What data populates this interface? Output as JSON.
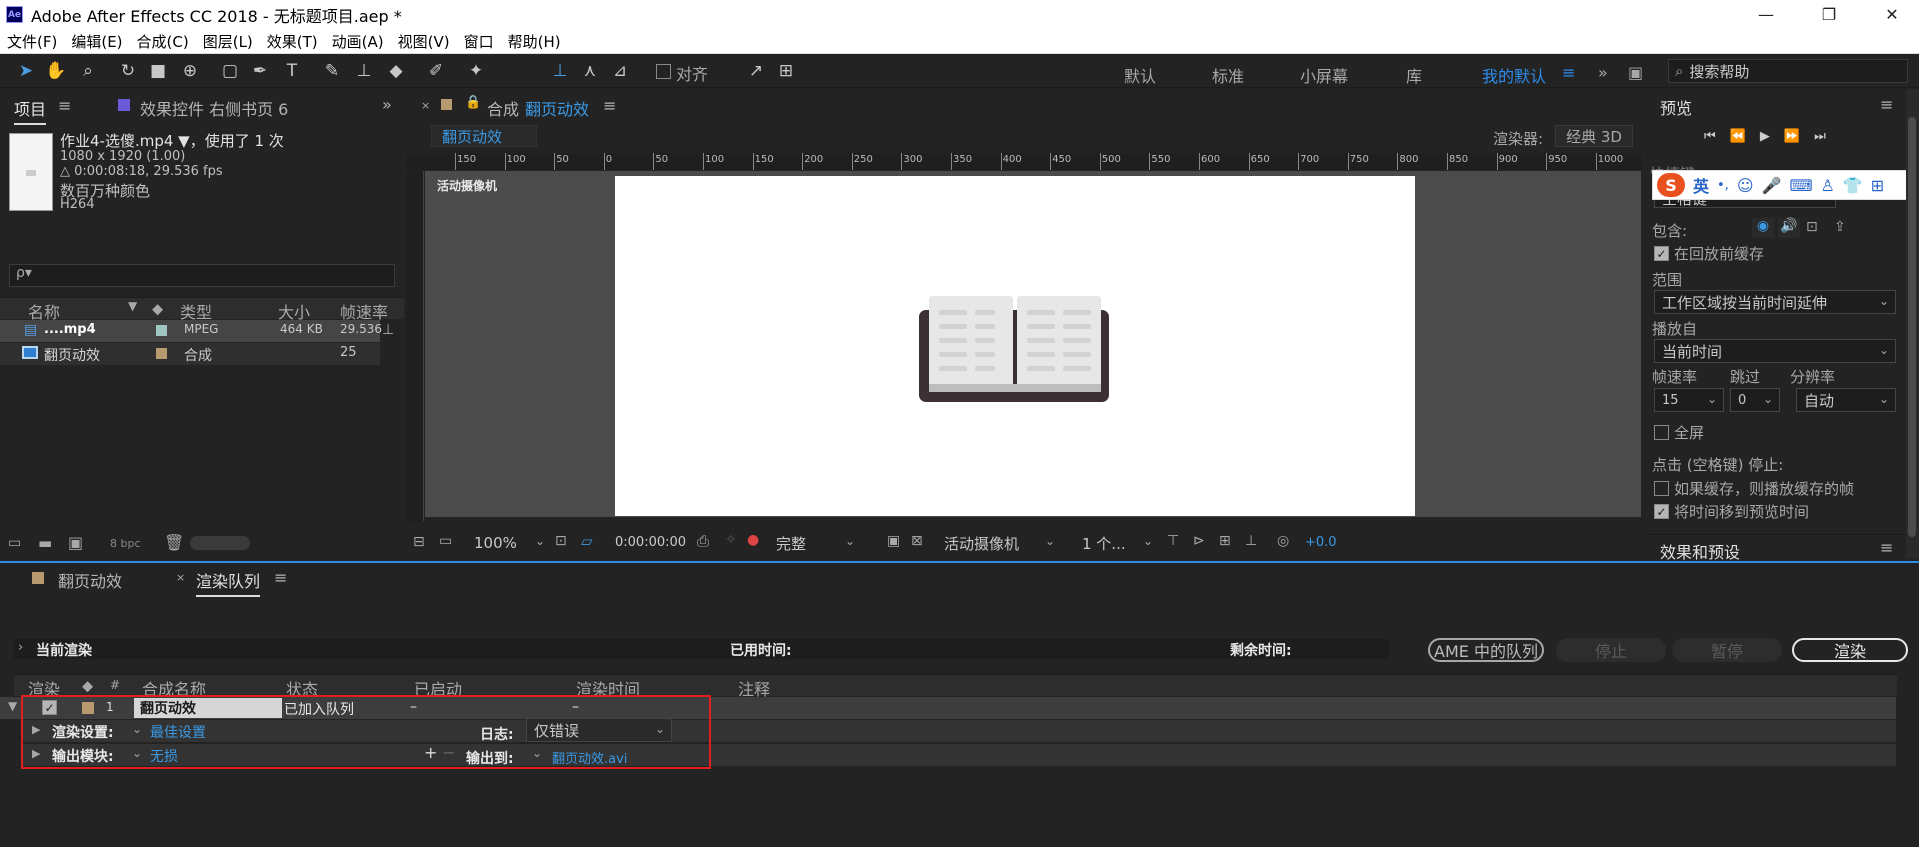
{
  "titlebar": {
    "title": "Adobe After Effects CC 2018 - 无标题项目.aep *",
    "logo": "Ae",
    "min": "—",
    "max": "❐",
    "close": "✕"
  },
  "menu": [
    "文件(F)",
    "编辑(E)",
    "合成(C)",
    "图层(L)",
    "效果(T)",
    "动画(A)",
    "视图(V)",
    "窗口",
    "帮助(H)"
  ],
  "toolbar": {
    "align_label": "对齐",
    "workspaces": [
      "默认",
      "标准",
      "小屏幕",
      "库",
      "我的默认"
    ],
    "search_placeholder": "搜索帮助"
  },
  "project_panel": {
    "tab_project": "项目",
    "tab_effects": "效果控件 右侧书页 6",
    "file_name": "作业4-选傻.mp4 ▼，使用了 1 次",
    "file_dims": "1080 x 1920 (1.00)",
    "file_duration": "△ 0:00:08:18, 29.536 fps",
    "file_colors": "数百万种颜色",
    "file_codec": "H264",
    "search_placeholder": "ρ▾",
    "columns": {
      "name": "名称",
      "type": "类型",
      "size": "大小",
      "fps": "帧速率"
    },
    "rows": [
      {
        "name": "....mp4",
        "type": "MPEG",
        "size": "464 KB",
        "fps": "29.536",
        "color": "#9fc6c0"
      },
      {
        "name": "翻页动效",
        "type": "合成",
        "size": "",
        "fps": "25",
        "color": "#b89a70"
      }
    ],
    "bpc": "8 bpc"
  },
  "comp_panel": {
    "tab_prefix": "合成",
    "tab_name": "翻页动效",
    "sub_tab": "翻页动效",
    "renderer_label": "渲染器:",
    "renderer_value": "经典 3D",
    "camera_label": "活动摄像机",
    "ruler_labels": [
      "150",
      "100",
      "50",
      "0",
      "50",
      "100",
      "150",
      "200",
      "250",
      "300",
      "350",
      "400",
      "450",
      "500",
      "550",
      "600",
      "650",
      "700",
      "750",
      "800",
      "850",
      "900",
      "950",
      "1000"
    ],
    "zoom": "100%",
    "timecode": "0:00:00:00",
    "quality": "完整",
    "view_camera": "活动摄像机",
    "view_count": "1 个...",
    "exposure": "+0.0"
  },
  "preview_panel": {
    "title": "预览",
    "shortcut_label": "快捷键",
    "shortcut_value": "空格键",
    "include_label": "包含:",
    "cache_label": "在回放前缓存",
    "range_label": "范围",
    "range_value": "工作区域按当前时间延伸",
    "play_from_label": "播放自",
    "play_from_value": "当前时间",
    "fps_label": "帧速率",
    "skip_label": "跳过",
    "res_label": "分辨率",
    "fps_value": "15",
    "skip_value": "0",
    "res_value": "自动",
    "fullscreen_label": "全屏",
    "stop_label": "点击 (空格键) 停止:",
    "opt1": "如果缓存，则播放缓存的帧",
    "opt2": "将时间移到预览时间",
    "effects_title": "效果和预设",
    "ime": {
      "logo": "S",
      "lang": "英",
      "punct": "•,"
    }
  },
  "render_panel": {
    "tab_comp": "翻页动效",
    "tab_queue": "渲染队列",
    "current_render": "当前渲染",
    "elapsed_label": "已用时间:",
    "remaining_label": "剩余时间:",
    "ame_button": "AME 中的队列",
    "stop_button": "停止",
    "pause_button": "暂停",
    "render_button": "渲染",
    "columns": {
      "render": "渲染",
      "num": "#",
      "comp": "合成名称",
      "status": "状态",
      "started": "已启动",
      "render_time": "渲染时间",
      "comment": "注释"
    },
    "item": {
      "num": "1",
      "name": "翻页动效",
      "status": "已加入队列",
      "started": "–",
      "render_time": "–"
    },
    "render_settings_label": "渲染设置:",
    "render_settings_value": "最佳设置",
    "log_label": "日志:",
    "log_value": "仅错误",
    "output_module_label": "输出模块:",
    "output_module_value": "无损",
    "output_to_label": "输出到:",
    "output_to_value": "翻页动效.avi"
  },
  "colors": {
    "accent": "#2d8ceb",
    "highlight_box": "#e02020",
    "titlebar_bg": "#ffffff",
    "panel_bg": "#232323"
  }
}
